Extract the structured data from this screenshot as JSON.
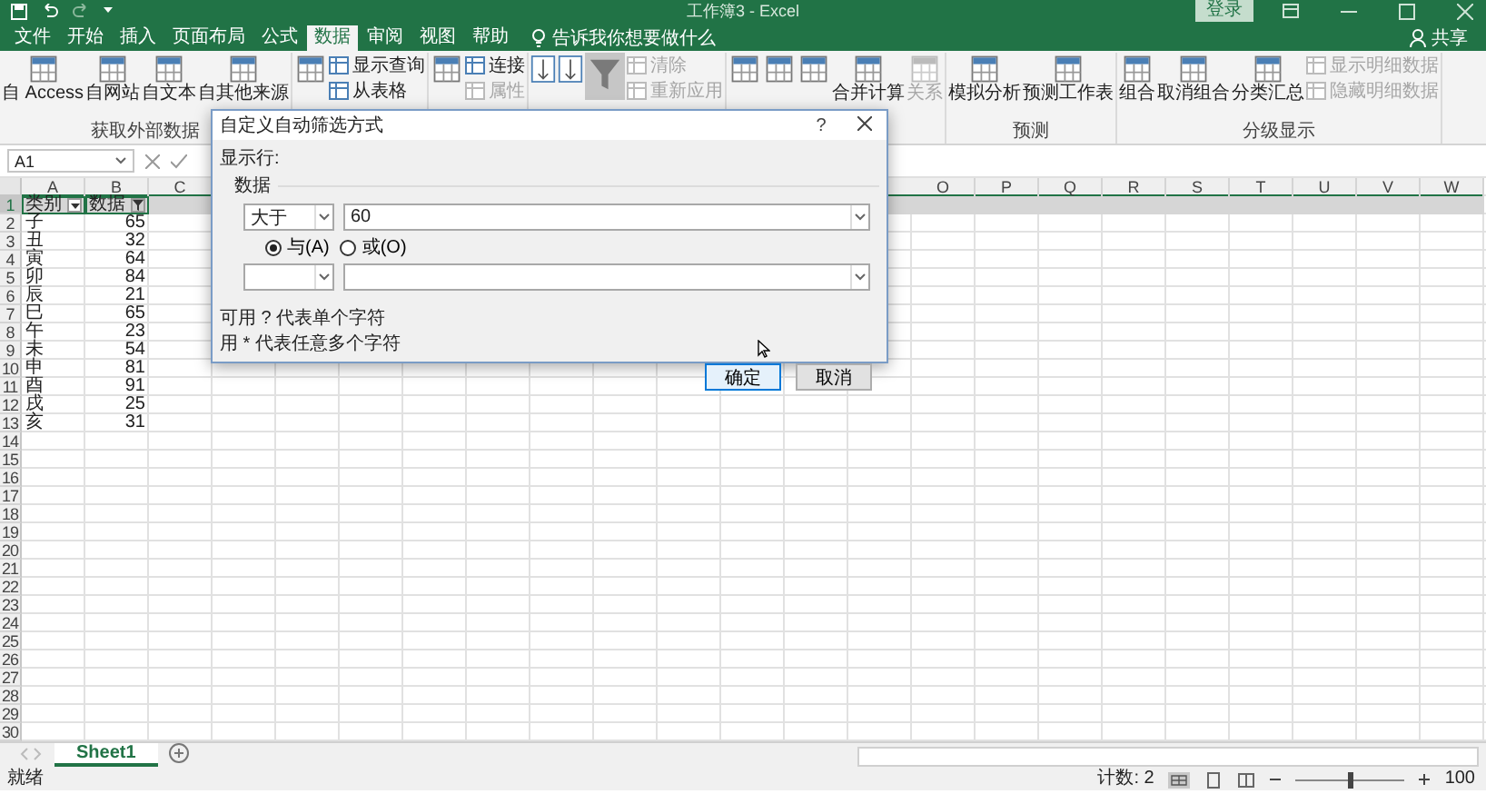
{
  "window": {
    "title": "工作簿3 - Excel",
    "sign_in": "登录"
  },
  "tabs": [
    {
      "label": "文件",
      "selected": false
    },
    {
      "label": "开始",
      "selected": false
    },
    {
      "label": "插入",
      "selected": false
    },
    {
      "label": "页面布局",
      "selected": false
    },
    {
      "label": "公式",
      "selected": false
    },
    {
      "label": "数据",
      "selected": true
    },
    {
      "label": "审阅",
      "selected": false
    },
    {
      "label": "视图",
      "selected": false
    },
    {
      "label": "帮助",
      "selected": false
    }
  ],
  "tell_me": {
    "placeholder": "告诉我你想要做什么"
  },
  "share": "共享",
  "ribbon": [
    {
      "label": "获取外部数据",
      "items": [
        {
          "kind": "large",
          "label": "自 Access",
          "disabled": false
        },
        {
          "kind": "large",
          "label": "自网站",
          "disabled": false
        },
        {
          "kind": "large",
          "label": "自文本",
          "disabled": false
        },
        {
          "kind": "large",
          "label": "自其他来源",
          "disabled": false
        }
      ]
    },
    {
      "items": [
        {
          "kind": "large",
          "disabled": false
        },
        {
          "kind": "small",
          "label": "显示查询",
          "disabled": false
        },
        {
          "kind": "small",
          "label": "从表格",
          "disabled": false
        }
      ]
    },
    {
      "items": [
        {
          "kind": "large",
          "disabled": false
        },
        {
          "kind": "small",
          "label": "连接",
          "disabled": false
        },
        {
          "kind": "small",
          "label": "属性",
          "disabled": true
        }
      ]
    },
    {
      "items": [
        {
          "kind": "sort",
          "disabled": false
        },
        {
          "kind": "sort",
          "disabled": false
        },
        {
          "kind": "filter",
          "selected": true,
          "disabled": false
        },
        {
          "kind": "small",
          "label": "清除",
          "disabled": true
        },
        {
          "kind": "small",
          "label": "重新应用",
          "disabled": true
        }
      ]
    },
    {
      "items": [
        {
          "kind": "large",
          "disabled": false
        },
        {
          "kind": "large",
          "disabled": false
        },
        {
          "kind": "large",
          "disabled": false
        },
        {
          "kind": "large",
          "label": "合并计算",
          "disabled": false
        },
        {
          "kind": "large",
          "label": "关系",
          "disabled": true
        }
      ]
    },
    {
      "label": "预测",
      "items": [
        {
          "kind": "large",
          "label": "模拟分析",
          "disabled": false
        },
        {
          "kind": "large",
          "label": "预测工作表",
          "disabled": false
        }
      ]
    },
    {
      "label": "分级显示",
      "items": [
        {
          "kind": "large",
          "label": "组合",
          "disabled": false
        },
        {
          "kind": "large",
          "label": "取消组合",
          "disabled": false
        },
        {
          "kind": "large",
          "label": "分类汇总",
          "disabled": false
        },
        {
          "kind": "small",
          "label": "显示明细数据",
          "disabled": true
        },
        {
          "kind": "small",
          "label": "隐藏明细数据",
          "disabled": true
        }
      ]
    }
  ],
  "formula_bar": {
    "name_box": "A1"
  },
  "sheet": {
    "columns_left": [
      "A",
      "B",
      "C"
    ],
    "columns_right": [
      "O",
      "P",
      "Q",
      "R",
      "S",
      "T",
      "U",
      "V",
      "W"
    ],
    "rows": [
      {
        "number": "1",
        "selected": true,
        "cells": [
          {
            "kind": "header",
            "text": "类别",
            "filter_active": false
          },
          {
            "kind": "header",
            "text": "数据",
            "filter_active": true
          }
        ]
      },
      {
        "number": "2",
        "selected": false,
        "cells": [
          {
            "kind": "text",
            "text": "子"
          },
          {
            "kind": "number",
            "text": "65"
          }
        ]
      },
      {
        "number": "3",
        "selected": false,
        "cells": [
          {
            "kind": "text",
            "text": "丑"
          },
          {
            "kind": "number",
            "text": "32"
          }
        ]
      },
      {
        "number": "4",
        "selected": false,
        "cells": [
          {
            "kind": "text",
            "text": "寅"
          },
          {
            "kind": "number",
            "text": "64"
          }
        ]
      },
      {
        "number": "5",
        "selected": false,
        "cells": [
          {
            "kind": "text",
            "text": "卯"
          },
          {
            "kind": "number",
            "text": "84"
          }
        ]
      },
      {
        "number": "6",
        "selected": false,
        "cells": [
          {
            "kind": "text",
            "text": "辰"
          },
          {
            "kind": "number",
            "text": "21"
          }
        ]
      },
      {
        "number": "7",
        "selected": false,
        "cells": [
          {
            "kind": "text",
            "text": "巳"
          },
          {
            "kind": "number",
            "text": "65"
          }
        ]
      },
      {
        "number": "8",
        "selected": false,
        "cells": [
          {
            "kind": "text",
            "text": "午"
          },
          {
            "kind": "number",
            "text": "23"
          }
        ]
      },
      {
        "number": "9",
        "selected": false,
        "cells": [
          {
            "kind": "text",
            "text": "未"
          },
          {
            "kind": "number",
            "text": "54"
          }
        ]
      },
      {
        "number": "10",
        "selected": false,
        "cells": [
          {
            "kind": "text",
            "text": "申"
          },
          {
            "kind": "number",
            "text": "81"
          }
        ]
      },
      {
        "number": "11",
        "selected": false,
        "cells": [
          {
            "kind": "text",
            "text": "酉"
          },
          {
            "kind": "number",
            "text": "91"
          }
        ]
      },
      {
        "number": "12",
        "selected": false,
        "cells": [
          {
            "kind": "text",
            "text": "戌"
          },
          {
            "kind": "number",
            "text": "25"
          }
        ]
      },
      {
        "number": "13",
        "selected": false,
        "cells": [
          {
            "kind": "text",
            "text": "亥"
          },
          {
            "kind": "number",
            "text": "31"
          }
        ]
      },
      {
        "number": "14",
        "selected": false
      },
      {
        "number": "15",
        "selected": false
      },
      {
        "number": "16",
        "selected": false
      },
      {
        "number": "17",
        "selected": false
      },
      {
        "number": "18",
        "selected": false
      },
      {
        "number": "19",
        "selected": false
      },
      {
        "number": "20",
        "selected": false
      },
      {
        "number": "21",
        "selected": false
      },
      {
        "number": "22",
        "selected": false
      },
      {
        "number": "23",
        "selected": false
      },
      {
        "number": "24",
        "selected": false
      },
      {
        "number": "25",
        "selected": false
      },
      {
        "number": "26",
        "selected": false
      },
      {
        "number": "27",
        "selected": false
      },
      {
        "number": "28",
        "selected": false
      },
      {
        "number": "29",
        "selected": false
      },
      {
        "number": "30",
        "selected": false
      }
    ]
  },
  "sheet_tabs": [
    {
      "label": "Sheet1",
      "selected": true
    }
  ],
  "status_bar": {
    "status": "就绪",
    "count": "计数: 2",
    "zoom": {
      "level": 0.5,
      "reading": "100"
    }
  },
  "dialog": {
    "title": "自定义自动筛选方式",
    "help": "?",
    "show_rows": "显示行:",
    "field": "数据",
    "conditions": [
      {
        "kind": "filled",
        "operator": "大于",
        "value": "60"
      },
      {
        "kind": "empty"
      }
    ],
    "logic": [
      {
        "label": "与(A)",
        "selected": true
      },
      {
        "label": "或(O)",
        "selected": false
      }
    ],
    "hints": [
      "可用 ? 代表单个字符",
      "用 * 代表任意多个字符"
    ],
    "buttons": [
      {
        "label": "确定",
        "default": true
      },
      {
        "label": "取消",
        "default": false
      }
    ]
  }
}
